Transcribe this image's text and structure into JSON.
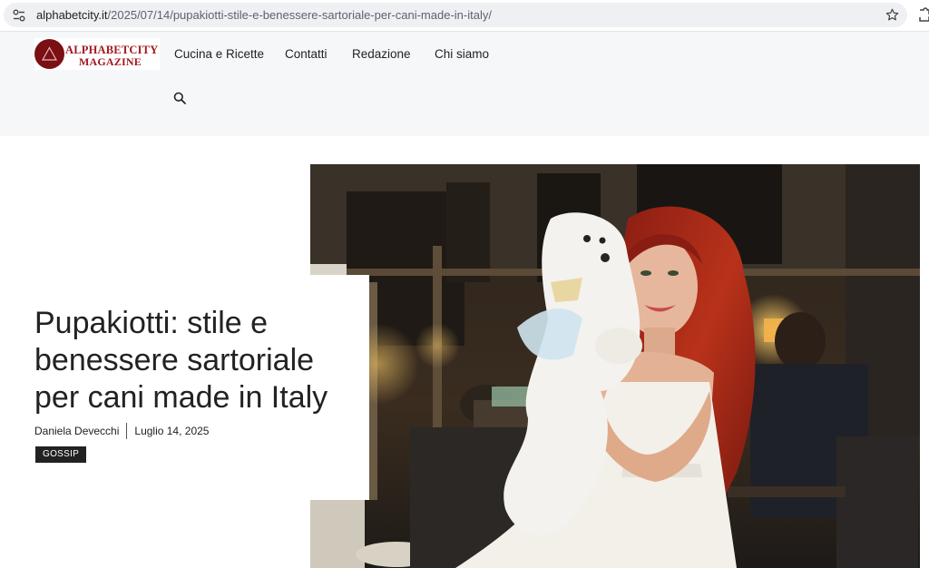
{
  "browser": {
    "url_host": "alphabetcity.it",
    "url_path": "/2025/07/14/pupakiotti-stile-e-benessere-sartoriale-per-cani-made-in-italy/",
    "icons": [
      "tune-icon",
      "star-icon",
      "extension-icon"
    ]
  },
  "site": {
    "logo_line1": "ALPHABETCITY",
    "logo_line2": "MAGAZINE",
    "brand_color": "#a3171f",
    "nav": [
      "Cucina e Ricette",
      "Contatti",
      "Redazione",
      "Chi siamo"
    ],
    "search_icon": "search-icon"
  },
  "article": {
    "title": "Pupakiotti: stile e benessere sartoriale per cani made in Italy",
    "author": "Daniela Devecchi",
    "date": "Luglio 14, 2025",
    "category": "GOSSIP"
  }
}
